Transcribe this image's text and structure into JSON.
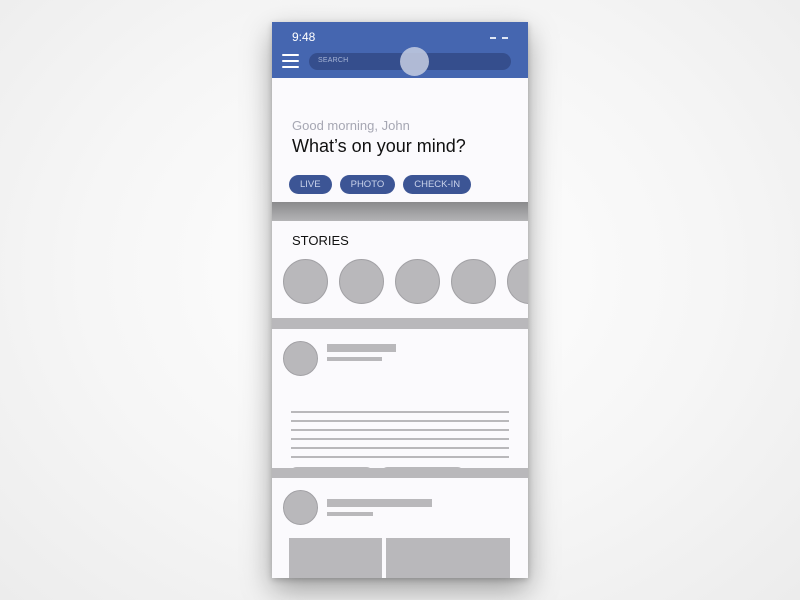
{
  "status_bar": {
    "time": "9:48",
    "signal_icon": "signal-dashes-icon"
  },
  "app_bar": {
    "menu_icon": "hamburger-menu-icon",
    "search": {
      "placeholder": "SEARCH",
      "value": ""
    },
    "brand_color": "#4566b0"
  },
  "compose": {
    "greeting": "Good morning, John",
    "prompt": "What’s on your mind?",
    "actions": [
      {
        "label": "LIVE"
      },
      {
        "label": "PHOTO"
      },
      {
        "label": "CHECK-IN"
      }
    ]
  },
  "stories": {
    "title": "STORIES",
    "count_visible": 5
  },
  "feed": {
    "posts": [
      {
        "type": "text-post",
        "text_lines": 6,
        "action_buttons": 2
      },
      {
        "type": "photo-post",
        "images": 2
      }
    ]
  }
}
